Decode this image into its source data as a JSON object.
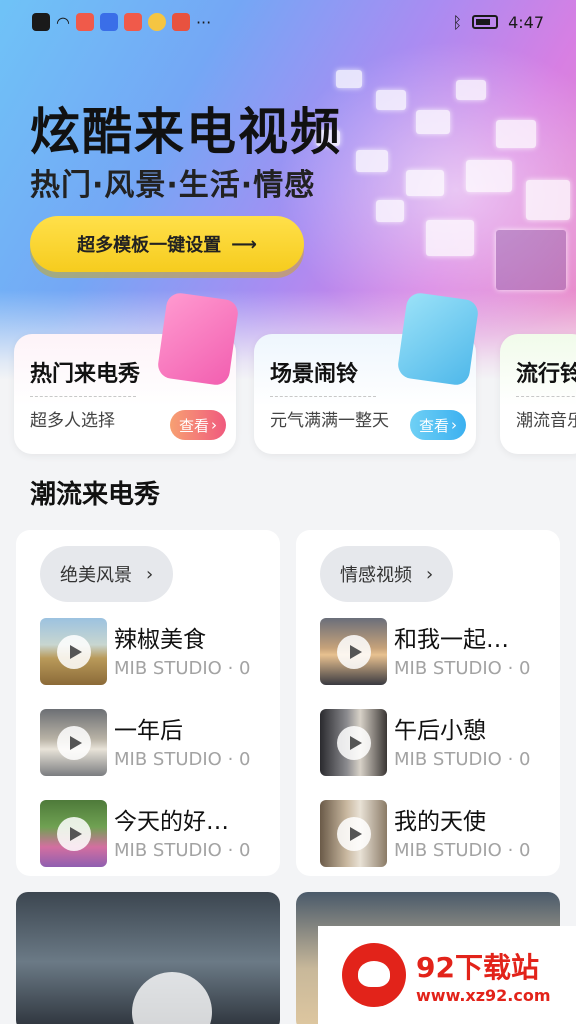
{
  "status_bar": {
    "time": "4:47"
  },
  "hero": {
    "title": "炫酷来电视频",
    "subtitle": "热门·风景·生活·情感",
    "button_label": "超多模板一键设置",
    "button_arrow": "⟶"
  },
  "categories": [
    {
      "title": "热门来电秀",
      "desc": "超多人选择",
      "view": "查看"
    },
    {
      "title": "场景闹铃",
      "desc": "元气满满一整天",
      "view": "查看"
    },
    {
      "title": "流行铃",
      "desc": "潮流音乐"
    }
  ],
  "section": {
    "title": "潮流来电秀"
  },
  "panels": [
    {
      "chip": "绝美风景",
      "items": [
        {
          "name": "辣椒美食",
          "meta": "MIB STUDIO · 0"
        },
        {
          "name": "一年后",
          "meta": "MIB STUDIO · 0"
        },
        {
          "name": "今天的好…",
          "meta": "MIB STUDIO · 0"
        }
      ]
    },
    {
      "chip": "情感视频",
      "items": [
        {
          "name": "和我一起…",
          "meta": "MIB STUDIO · 0"
        },
        {
          "name": "午后小憩",
          "meta": "MIB STUDIO · 0"
        },
        {
          "name": "我的天使",
          "meta": "MIB STUDIO · 0"
        }
      ]
    }
  ],
  "watermark": {
    "name": "92下载站",
    "url": "www.xz92.com"
  },
  "colors": {
    "accent_yellow": "#f6cc1e",
    "view_pink": "#f05a7e",
    "view_blue": "#3bb0f0"
  }
}
